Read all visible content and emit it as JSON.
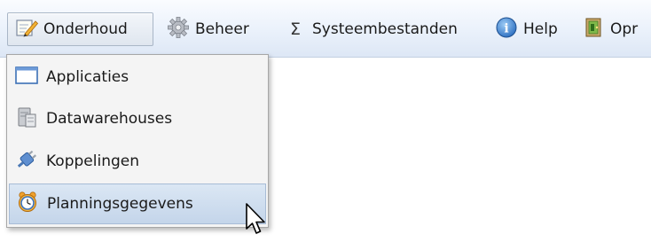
{
  "menubar": {
    "items": [
      {
        "label": "Onderhoud",
        "icon": "pencil-note-icon"
      },
      {
        "label": "Beheer",
        "icon": "gear-icon"
      },
      {
        "label": "Systeembestanden",
        "icon": "sigma-icon",
        "glyph": "Σ"
      },
      {
        "label": "Help",
        "icon": "info-icon",
        "glyph": "i"
      },
      {
        "label": "Opr",
        "icon": "exit-door-icon"
      }
    ]
  },
  "dropdown": {
    "items": [
      {
        "label": "Applicaties",
        "icon": "window-icon"
      },
      {
        "label": "Datawarehouses",
        "icon": "database-server-icon"
      },
      {
        "label": "Koppelingen",
        "icon": "plug-icon"
      },
      {
        "label": "Planningsgegevens",
        "icon": "alarm-clock-icon",
        "highlighted": true
      }
    ]
  }
}
